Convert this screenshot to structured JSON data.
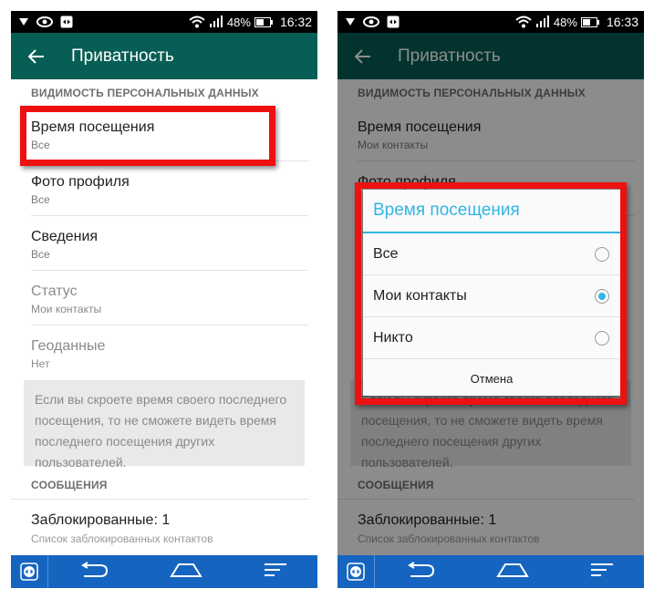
{
  "left": {
    "status": {
      "battery_pct": "48%",
      "time": "16:32"
    },
    "appbar": {
      "title": "Приватность"
    },
    "section1": "ВИДИМОСТЬ ПЕРСОНАЛЬНЫХ ДАННЫХ",
    "items": [
      {
        "title": "Время посещения",
        "value": "Все"
      },
      {
        "title": "Фото профиля",
        "value": "Все"
      },
      {
        "title": "Сведения",
        "value": "Все"
      },
      {
        "title": "Статус",
        "value": "Мои контакты"
      },
      {
        "title": "Геоданные",
        "value": "Нет"
      }
    ],
    "note": "Если вы скроете время своего последнего посещения, то не сможете видеть время последнего посещения других пользователей.",
    "section2": "СООБЩЕНИЯ",
    "blocked": {
      "title": "Заблокированные: 1",
      "subtitle": "Список заблокированных контактов"
    }
  },
  "right": {
    "status": {
      "battery_pct": "48%",
      "time": "16:33"
    },
    "appbar": {
      "title": "Приватность"
    },
    "section1": "ВИДИМОСТЬ ПЕРСОНАЛЬНЫХ ДАННЫХ",
    "items": [
      {
        "title": "Время посещения",
        "value": "Мои контакты"
      },
      {
        "title": "Фото профиля",
        "value": ""
      }
    ],
    "note": "Если вы скроете время своего последнего посещения, то не сможете видеть время последнего посещения других пользователей.",
    "section2": "СООБЩЕНИЯ",
    "blocked": {
      "title": "Заблокированные: 1",
      "subtitle": "Список заблокированных контактов"
    },
    "dialog": {
      "title": "Время посещения",
      "options": [
        {
          "label": "Все",
          "selected": false
        },
        {
          "label": "Мои контакты",
          "selected": true
        },
        {
          "label": "Никто",
          "selected": false
        }
      ],
      "cancel": "Отмена"
    }
  },
  "colors": {
    "appbar": "#075e54",
    "accent": "#33b5e5",
    "highlight": "#ee1111",
    "navbar": "#1565c0"
  },
  "icons": [
    "back-arrow-icon",
    "wifi-icon",
    "signal-icon",
    "battery-icon",
    "teamviewer-icon",
    "nav-back-icon",
    "nav-home-icon",
    "nav-recents-icon"
  ]
}
